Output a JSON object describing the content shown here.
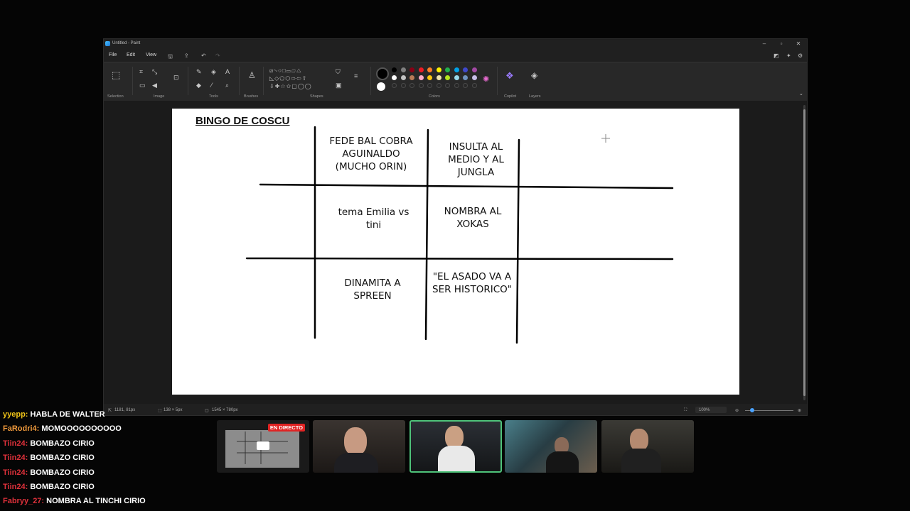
{
  "paint": {
    "window_title": "Untitled - Paint",
    "menu": [
      "File",
      "Edit",
      "View"
    ],
    "groups": [
      "Selection",
      "Image",
      "Tools",
      "Brushes",
      "Shapes",
      "Colors",
      "Copilot",
      "Layers"
    ],
    "status": {
      "cursor_pos": "1181, 81px",
      "selection_size": "138 × 5px",
      "image_size": "1545 × 780px",
      "zoom": "100%"
    },
    "palette_row1": [
      "#000000",
      "#7f7f7f",
      "#880015",
      "#ed1c24",
      "#ff7f27",
      "#fff200",
      "#22b14c",
      "#00a2e8",
      "#3f48cc",
      "#a349a4"
    ],
    "palette_row2": [
      "#ffffff",
      "#c3c3c3",
      "#b97a57",
      "#ffaec9",
      "#ffc90e",
      "#efe4b0",
      "#b5e61d",
      "#99d9ea",
      "#7092be",
      "#c8bfe7"
    ]
  },
  "document": {
    "title": "BINGO DE COSCU",
    "cells": {
      "r1c1": "FEDE BAL COBRA AGUINALDO (MUCHO ORIN)",
      "r1c2": "INSULTA AL MEDIO Y AL JUNGLA",
      "r2c1": "tema Emilia vs tini",
      "r2c2": "NOMBRA AL XOKAS",
      "r3c1": "DINAMITA A SPREEN",
      "r3c2": "\"EL ASADO VA A SER HISTORICO\""
    }
  },
  "chat": [
    {
      "user": "yyepp:",
      "text": "HABLA DE WALTER",
      "color": "#f0c419"
    },
    {
      "user": "FaRodri4:",
      "text": "MOMOOOOOOOOOO",
      "color": "#f09a3c"
    },
    {
      "user": "Tiin24:",
      "text": "BOMBAZO CIRIO",
      "color": "#e0313b"
    },
    {
      "user": "Tiin24:",
      "text": "BOMBAZO CIRIO",
      "color": "#e0313b"
    },
    {
      "user": "Tiin24:",
      "text": "BOMBAZO CIRIO",
      "color": "#e0313b"
    },
    {
      "user": "Tiin24:",
      "text": "BOMBAZO CIRIO",
      "color": "#e0313b"
    },
    {
      "user": "Fabryy_27:",
      "text": "NOMBRA AL TINCHI CIRIO",
      "color": "#e0313b"
    }
  ],
  "live_badge": "EN DIRECTO"
}
